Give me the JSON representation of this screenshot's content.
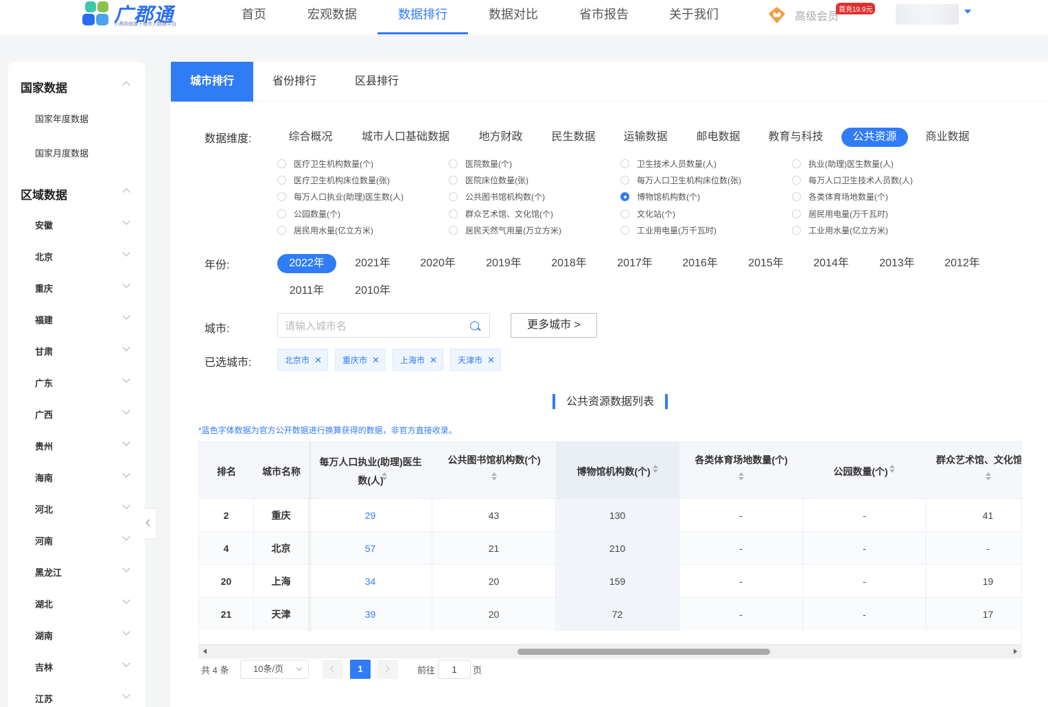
{
  "brand": {
    "name": "广郡通",
    "tagline": "小黑网络旗下城市大数据平台",
    "colors": [
      "#2a6df4",
      "#3cc8a8",
      "#8bc34a",
      "#4aa3f0"
    ]
  },
  "topnav": {
    "items": [
      "首页",
      "宏观数据",
      "数据排行",
      "数据对比",
      "省市报告",
      "关于我们"
    ],
    "active": "数据排行",
    "vip_label": "高级会员",
    "vip_badge": "首充19.9元"
  },
  "sidebar": {
    "groups": [
      {
        "title": "国家数据",
        "items": [
          "国家年度数据",
          "国家月度数据"
        ]
      },
      {
        "title": "区域数据",
        "items": [
          "安徽",
          "北京",
          "重庆",
          "福建",
          "甘肃",
          "广东",
          "广西",
          "贵州",
          "海南",
          "河北",
          "河南",
          "黑龙江",
          "湖北",
          "湖南",
          "吉林",
          "江苏"
        ]
      }
    ]
  },
  "tabs": [
    "城市排行",
    "省份排行",
    "区县排行"
  ],
  "labels": {
    "dimension": "数据维度:",
    "year": "年份:",
    "city": "城市:",
    "selected_cities": "已选城市:"
  },
  "dimensions": {
    "items": [
      "综合概况",
      "城市人口基础数据",
      "地方财政",
      "民生数据",
      "运输数据",
      "邮电数据",
      "教育与科技",
      "公共资源",
      "商业数据"
    ],
    "active": "公共资源"
  },
  "metrics": {
    "items": [
      "医疗卫生机构数量(个)",
      "医院数量(个)",
      "卫生技术人员数量(人)",
      "执业(助理)医生数量(人)",
      "医疗卫生机构床位数量(张)",
      "医院床位数量(张)",
      "每万人口卫生机构床位数(张)",
      "每万人口卫生技术人员数(人)",
      "每万人口执业(助理)医生数(人)",
      "公共图书馆机构数(个)",
      "博物馆机构数(个)",
      "各类体育场地数量(个)",
      "公园数量(个)",
      "群众艺术馆、文化馆(个)",
      "文化站(个)",
      "居民用电量(万千瓦时)",
      "居民用水量(亿立方米)",
      "居民天然气用量(万立方米)",
      "工业用电量(万千瓦时)",
      "工业用水量(亿立方米)"
    ],
    "checked": "博物馆机构数(个)"
  },
  "years": {
    "items": [
      "2022年",
      "2021年",
      "2020年",
      "2019年",
      "2018年",
      "2017年",
      "2016年",
      "2015年",
      "2014年",
      "2013年",
      "2012年",
      "2011年",
      "2010年"
    ],
    "active": "2022年"
  },
  "city_search": {
    "placeholder": "请输入城市名",
    "value": ""
  },
  "more_cities": "更多城市 >",
  "selected_cities": [
    "北京市",
    "重庆市",
    "上海市",
    "天津市"
  ],
  "table": {
    "title": "公共资源数据列表",
    "note": "*蓝色字体数据为官方公开数据进行换算获得的数据，非官方直接收录。",
    "columns": [
      "排名",
      "城市名称",
      "每万人口执业(助理)医生数(人)",
      "公共图书馆机构数(个)",
      "博物馆机构数(个)",
      "各类体育场地数量(个)",
      "公园数量(个)",
      "群众艺术馆、文化馆"
    ],
    "rows": [
      [
        "2",
        "重庆",
        "29",
        "43",
        "130",
        "-",
        "-",
        "41"
      ],
      [
        "4",
        "北京",
        "57",
        "21",
        "210",
        "-",
        "-",
        "-"
      ],
      [
        "20",
        "上海",
        "34",
        "20",
        "159",
        "-",
        "-",
        "19"
      ],
      [
        "21",
        "天津",
        "39",
        "20",
        "72",
        "-",
        "-",
        "17"
      ]
    ]
  },
  "pagination": {
    "total": "共 4 条",
    "page_size": "10条/页",
    "current": "1",
    "goto_prefix": "前往",
    "goto_value": "1",
    "goto_suffix": "页"
  }
}
